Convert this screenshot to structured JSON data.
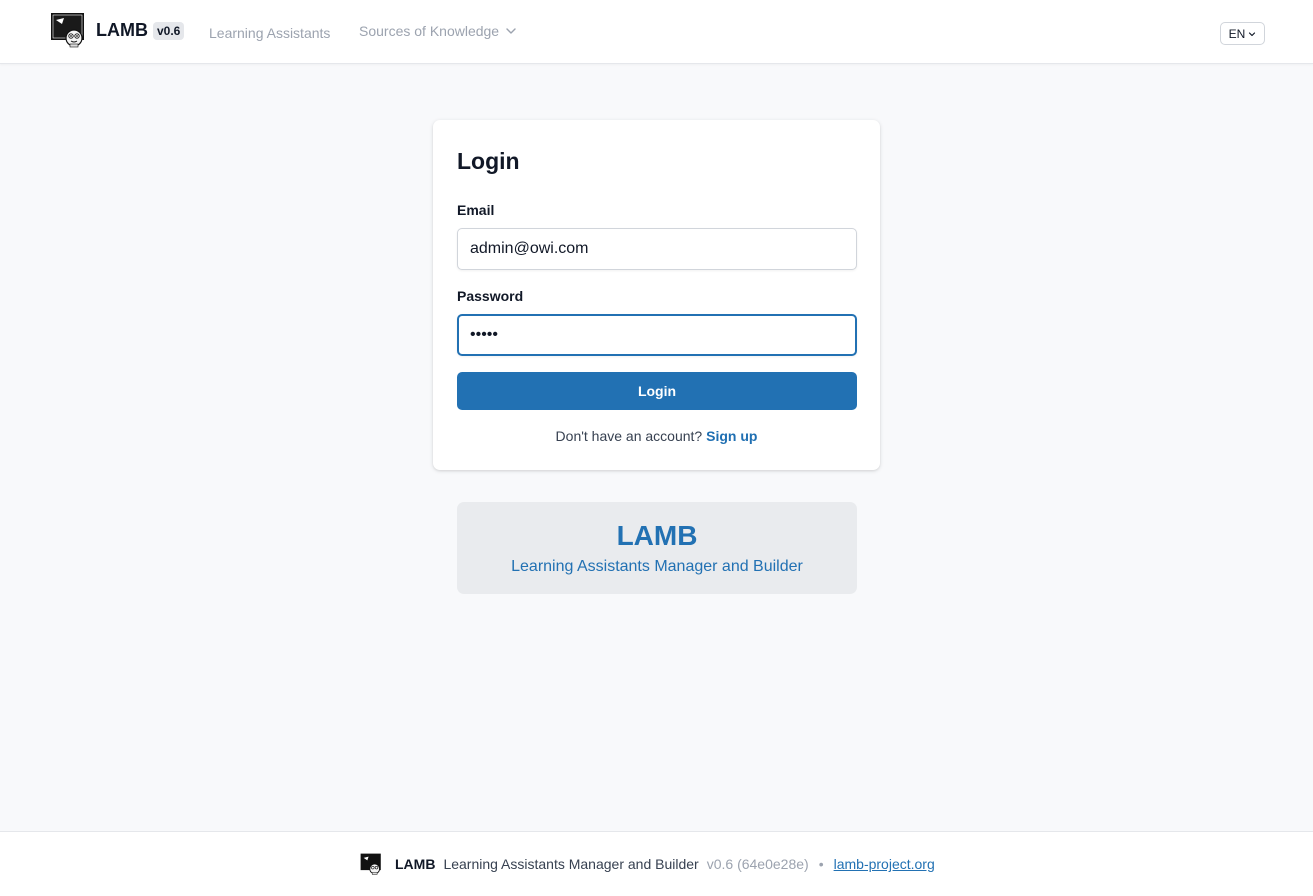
{
  "header": {
    "brand": "LAMB",
    "version": "v0.6",
    "nav": {
      "assistants": "Learning Assistants",
      "sources": "Sources of Knowledge"
    },
    "language": "EN"
  },
  "login": {
    "title": "Login",
    "email_label": "Email",
    "email_value": "admin@owi.com",
    "password_label": "Password",
    "password_value": "•••••",
    "button": "Login",
    "signup_prompt": "Don't have an account?",
    "signup_link": "Sign up"
  },
  "promo": {
    "title": "LAMB",
    "subtitle": "Learning Assistants Manager and Builder"
  },
  "footer": {
    "brand": "LAMB",
    "description": "Learning Assistants Manager and Builder",
    "version": "v0.6 (64e0e28e)",
    "separator": "•",
    "link": "lamb-project.org"
  },
  "colors": {
    "accent": "#2271b3",
    "background": "#f8f9fb",
    "promo_bg": "#e9ebee"
  },
  "icons": {
    "logo": "lamb-logo-icon",
    "dropdown": "chevron-down-icon"
  }
}
